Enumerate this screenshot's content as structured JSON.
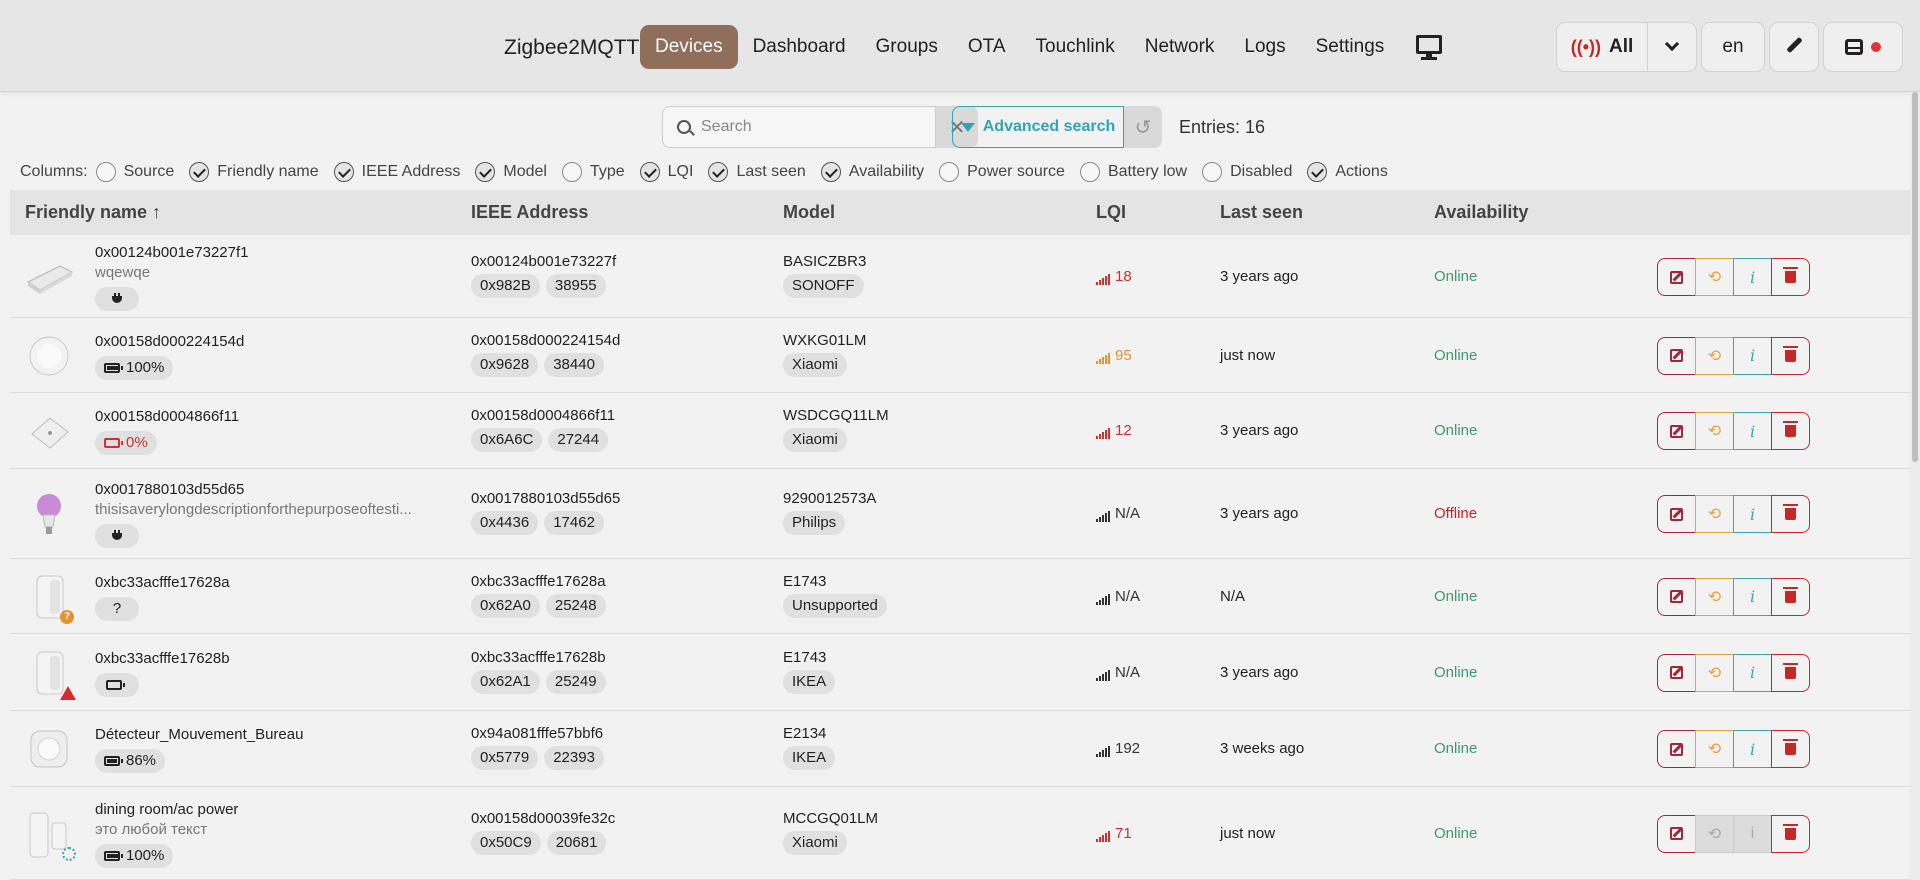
{
  "nav": {
    "brand": "Zigbee2MQTT",
    "links": [
      "Devices",
      "Dashboard",
      "Groups",
      "OTA",
      "Touchlink",
      "Network",
      "Logs",
      "Settings"
    ],
    "active": "Devices",
    "bridge_select": "All",
    "language": "en"
  },
  "search": {
    "placeholder": "Search",
    "value": "",
    "advanced_label": "Advanced search",
    "entries_label": "Entries: 16"
  },
  "columns": {
    "label": "Columns:",
    "options": [
      {
        "name": "Source",
        "checked": false
      },
      {
        "name": "Friendly name",
        "checked": true
      },
      {
        "name": "IEEE Address",
        "checked": true
      },
      {
        "name": "Model",
        "checked": true
      },
      {
        "name": "Type",
        "checked": false
      },
      {
        "name": "LQI",
        "checked": true
      },
      {
        "name": "Last seen",
        "checked": true
      },
      {
        "name": "Availability",
        "checked": true
      },
      {
        "name": "Power source",
        "checked": false
      },
      {
        "name": "Battery low",
        "checked": false
      },
      {
        "name": "Disabled",
        "checked": false
      },
      {
        "name": "Actions",
        "checked": true
      }
    ]
  },
  "table": {
    "headers": {
      "friendly": "Friendly name ↑",
      "ieee": "IEEE Address",
      "model": "Model",
      "lqi": "LQI",
      "last_seen": "Last seen",
      "availability": "Availability"
    },
    "rows": [
      {
        "name": "0x00124b001e73227f1",
        "desc": "wqewqe",
        "power": "plug",
        "power_text": "",
        "ieee": "0x00124b001e73227f",
        "nwk": "0x982B",
        "nwk_dec": "38955",
        "model": "BASICZBR3",
        "vendor": "SONOFF",
        "lqi": "18",
        "lqi_color": "red",
        "last_seen": "3 years ago",
        "availability": "Online"
      },
      {
        "name": "0x00158d000224154d",
        "desc": "",
        "power": "battery",
        "battery_level": 1.0,
        "power_text": "100%",
        "ieee": "0x00158d000224154d",
        "nwk": "0x9628",
        "nwk_dec": "38440",
        "model": "WXKG01LM",
        "vendor": "Xiaomi",
        "lqi": "95",
        "lqi_color": "orange",
        "last_seen": "just now",
        "availability": "Online"
      },
      {
        "name": "0x00158d0004866f11",
        "desc": "",
        "power": "battery-low",
        "battery_level": 0.0,
        "power_text": "0%",
        "ieee": "0x00158d0004866f11",
        "nwk": "0x6A6C",
        "nwk_dec": "27244",
        "model": "WSDCGQ11LM",
        "vendor": "Xiaomi",
        "lqi": "12",
        "lqi_color": "red",
        "last_seen": "3 years ago",
        "availability": "Online"
      },
      {
        "name": "0x0017880103d55d65",
        "desc": "thisisaverylongdescriptionforthepurposeoftesti...",
        "power": "plug",
        "power_text": "",
        "ieee": "0x0017880103d55d65",
        "nwk": "0x4436",
        "nwk_dec": "17462",
        "model": "9290012573A",
        "vendor": "Philips",
        "lqi": "N/A",
        "lqi_color": "dark",
        "last_seen": "3 years ago",
        "availability": "Offline"
      },
      {
        "name": "0xbc33acfffe17628a",
        "desc": "",
        "power": "unknown",
        "power_text": "?",
        "ieee": "0xbc33acfffe17628a",
        "nwk": "0x62A0",
        "nwk_dec": "25248",
        "model": "E1743",
        "vendor": "Unsupported",
        "lqi": "N/A",
        "lqi_color": "dark",
        "last_seen": "N/A",
        "availability": "Online"
      },
      {
        "name": "0xbc33acfffe17628b",
        "desc": "",
        "power": "battery",
        "battery_level": 0.0,
        "power_text": "",
        "ieee": "0xbc33acfffe17628b",
        "nwk": "0x62A1",
        "nwk_dec": "25249",
        "model": "E1743",
        "vendor": "IKEA",
        "lqi": "N/A",
        "lqi_color": "dark",
        "last_seen": "3 years ago",
        "availability": "Online"
      },
      {
        "name": "Détecteur_Mouvement_Bureau",
        "desc": "",
        "power": "battery",
        "battery_level": 0.86,
        "power_text": "86%",
        "ieee": "0x94a081fffe57bbf6",
        "nwk": "0x5779",
        "nwk_dec": "22393",
        "model": "E2134",
        "vendor": "IKEA",
        "lqi": "192",
        "lqi_color": "dark",
        "last_seen": "3 weeks ago",
        "availability": "Online"
      },
      {
        "name": "dining room/ac power",
        "desc": "это любой текст",
        "power": "battery",
        "battery_level": 1.0,
        "power_text": "100%",
        "ieee": "0x00158d00039fe32c",
        "nwk": "0x50C9",
        "nwk_dec": "20681",
        "model": "MCCGQ01LM",
        "vendor": "Xiaomi",
        "lqi": "71",
        "lqi_color": "red",
        "last_seen": "just now",
        "availability": "Online"
      }
    ]
  }
}
